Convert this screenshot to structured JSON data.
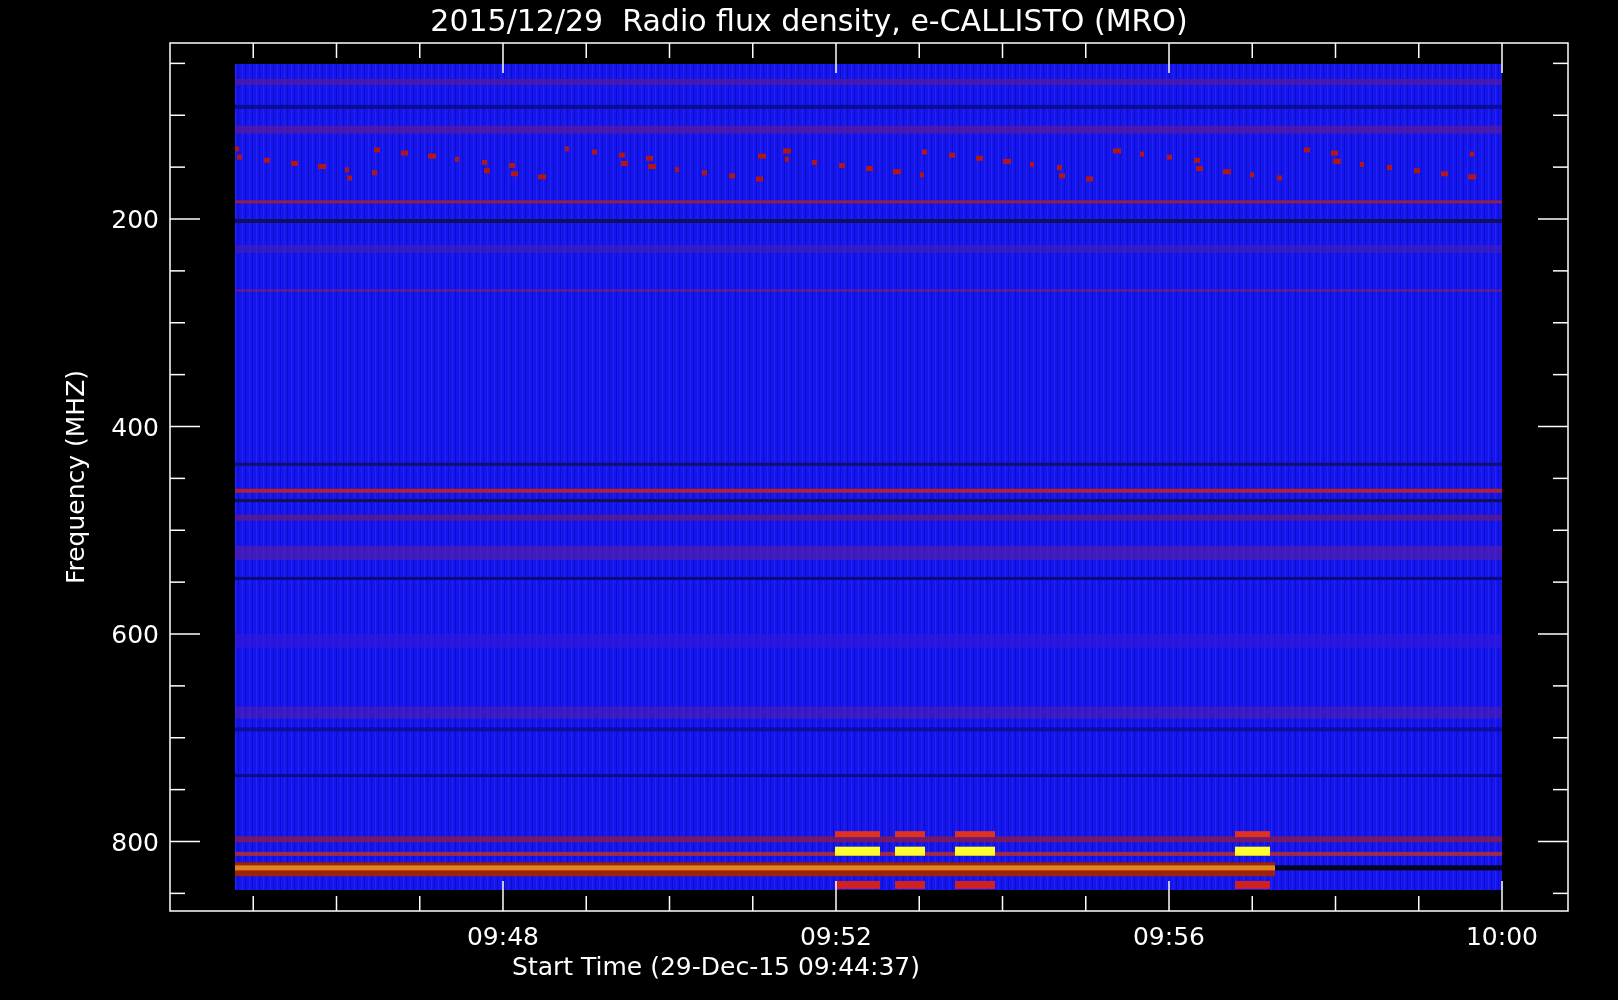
{
  "title": "2015/12/29  Radio flux density, e-CALLISTO (MRO)",
  "y_axis": {
    "label": "Frequency (MHZ)",
    "ticks": [
      "200",
      "400",
      "600",
      "800"
    ]
  },
  "x_axis": {
    "label": "Start Time (29-Dec-15 09:44:37)",
    "ticks": [
      "09:48",
      "09:52",
      "09:56",
      "10:00"
    ]
  }
}
